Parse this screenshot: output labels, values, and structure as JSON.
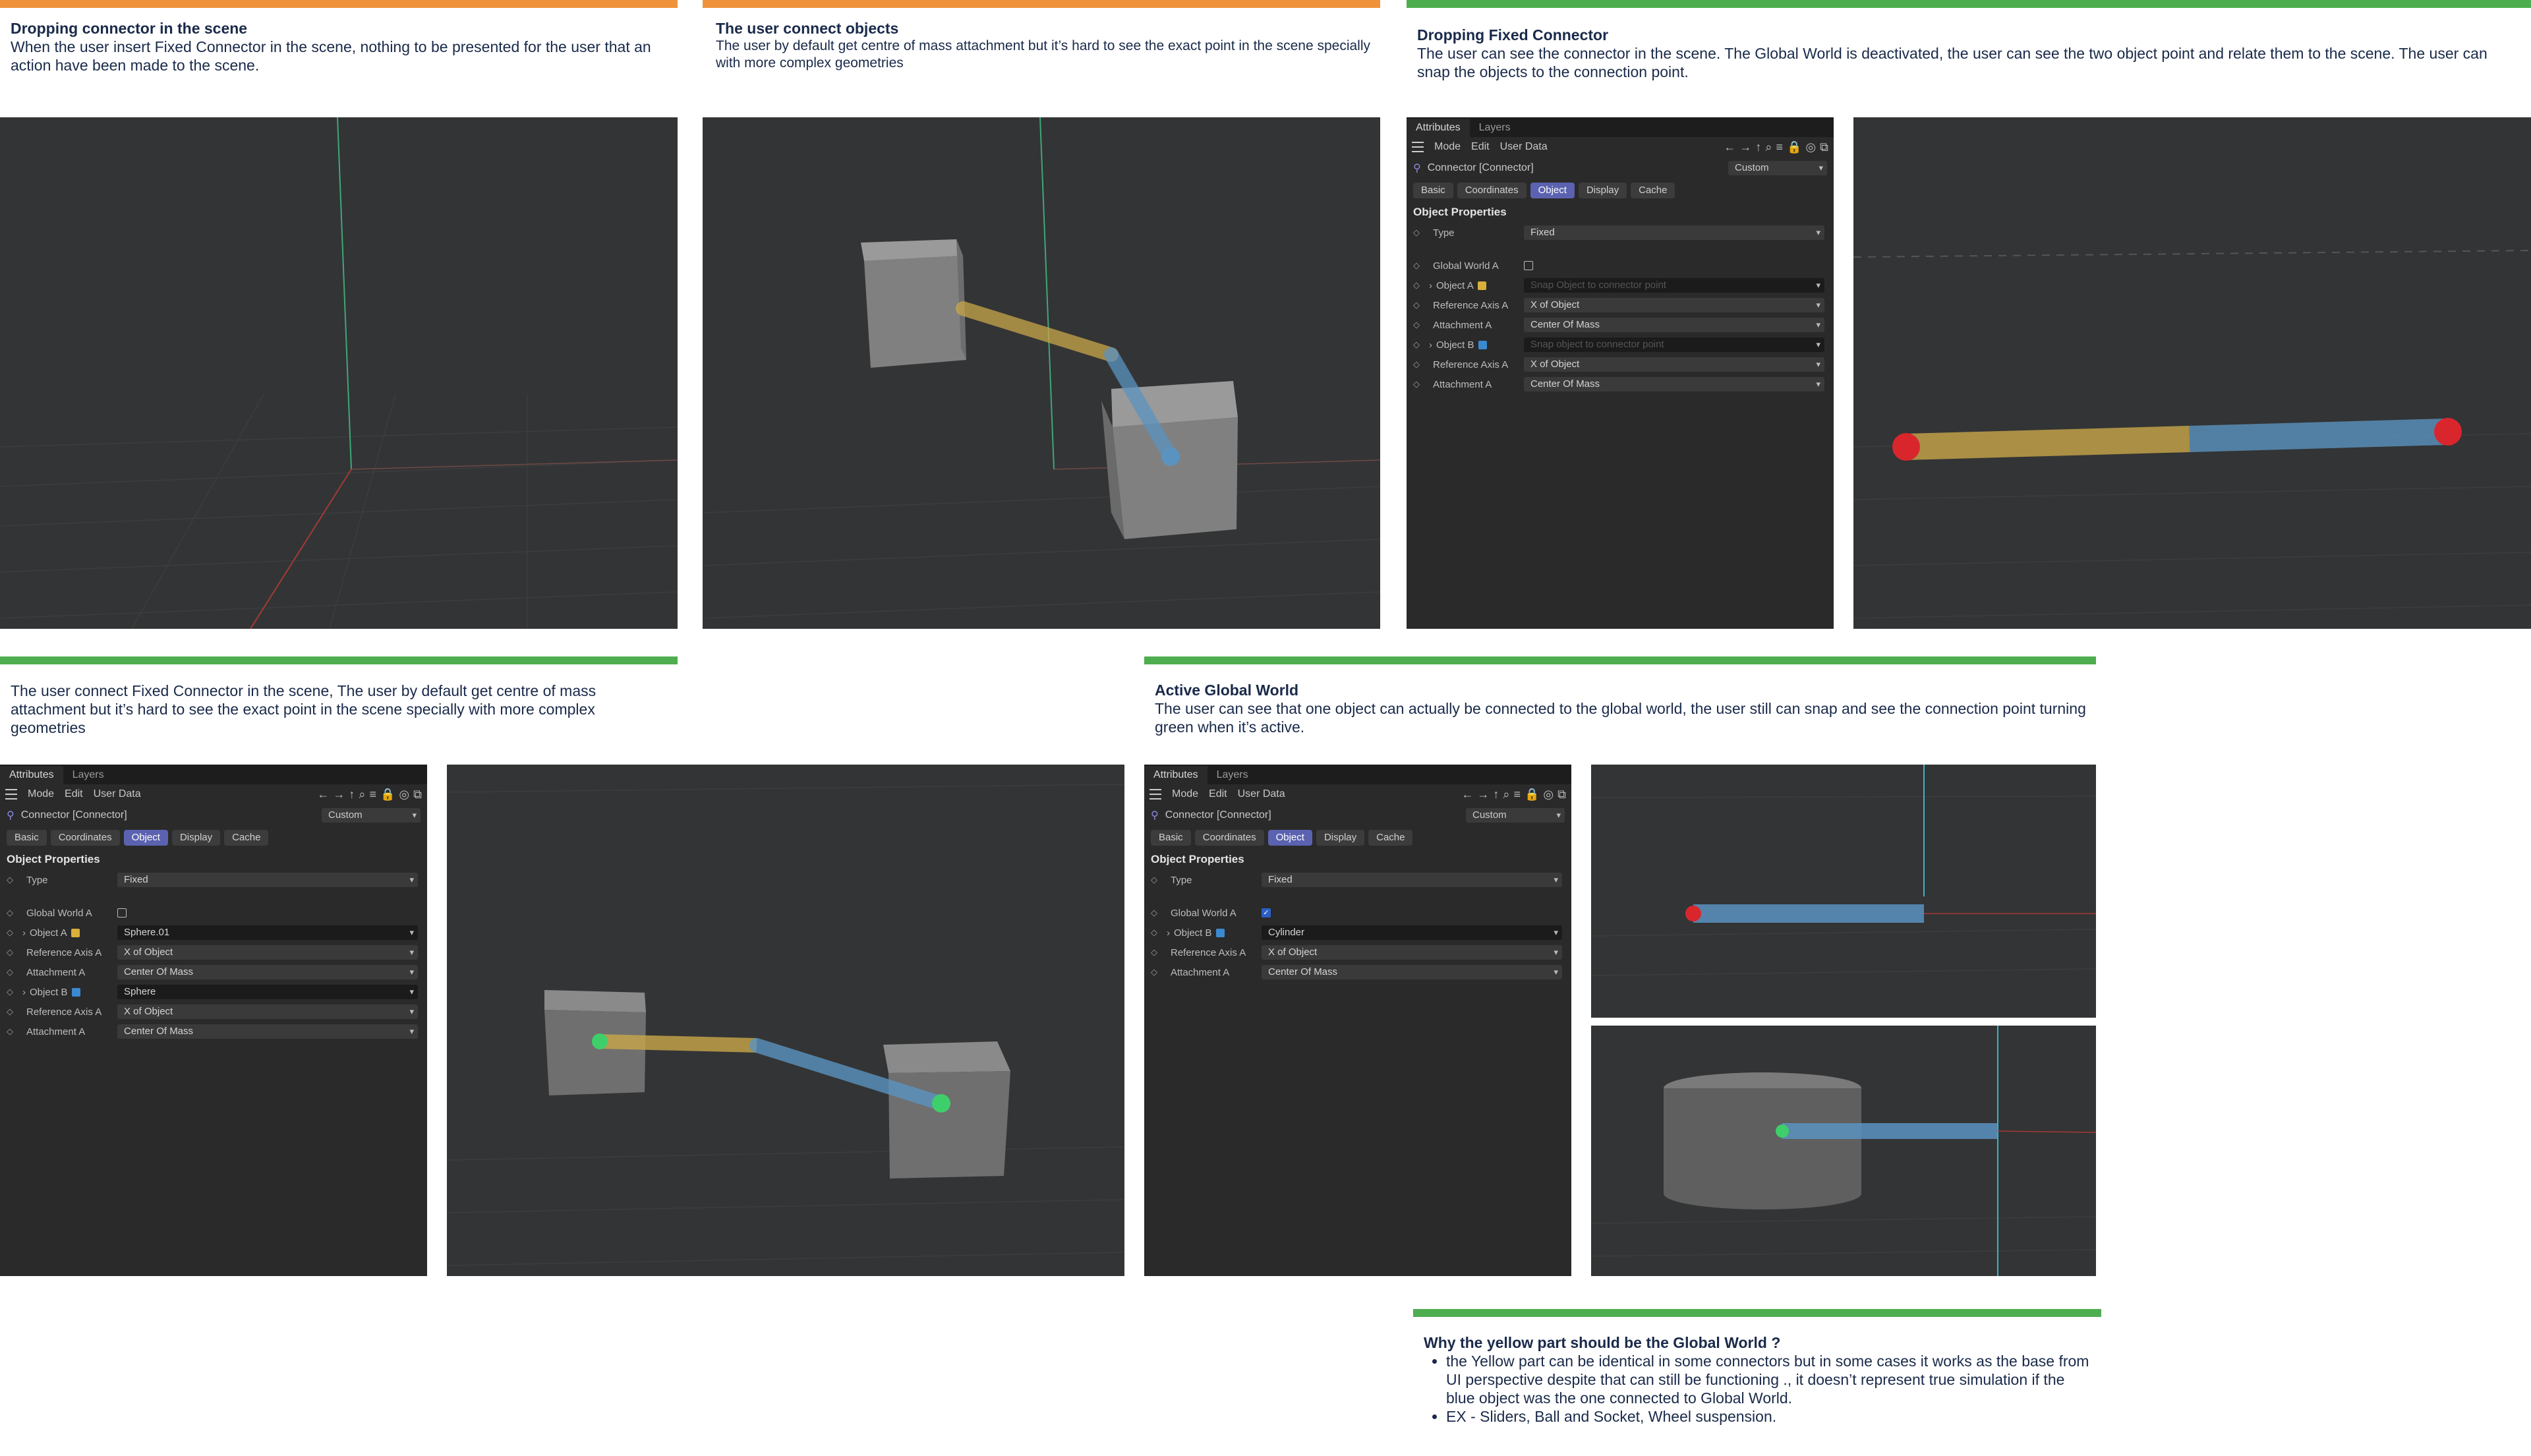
{
  "sections": {
    "s1": {
      "title": "Dropping connector in the scene",
      "body": "When the user insert Fixed Connector in the scene, nothing to be presented for the user that an action have been made to the scene."
    },
    "s2": {
      "title": "The user connect objects",
      "body": "The user by default get centre of mass attachment but it’s hard to see the exact point in the scene specially with more complex geometries"
    },
    "s3": {
      "title": "Dropping Fixed Connector",
      "body": "The user can see the connector in the scene. The Global World is deactivated, the user can see the two object point and relate them to the scene. The user can snap the objects to the connection point."
    },
    "s4": {
      "body": "The user connect Fixed Connector in the scene, The user by default get centre of mass attachment but it’s hard to see the exact point in the scene specially with more complex geometries"
    },
    "s5": {
      "title": "Active Global World",
      "body": "The user can see that one object can actually be connected to the global world, the user still can snap and see the connection point turning green when it’s active."
    },
    "s6": {
      "title": "Why the yellow part should be the Global World ?",
      "bullets": [
        "the Yellow part can be identical in some connectors but in some cases it works as the base from UI perspective despite that can still be functioning ., it doesn’t represent true simulation if the blue object was the one connected to Global World.",
        "EX - Sliders, Ball and Socket, Wheel suspension."
      ]
    }
  },
  "panel": {
    "tabs": [
      "Attributes",
      "Layers"
    ],
    "toolbar": [
      "Mode",
      "Edit",
      "User Data"
    ],
    "object_name": "Connector [Connector]",
    "preset": "Custom",
    "subtabs": [
      "Basic",
      "Coordinates",
      "Object",
      "Display",
      "Cache"
    ],
    "section": "Object Properties",
    "labels": {
      "type": "Type",
      "global_world": "Global World A",
      "object_a": "Object A",
      "ref_axis": "Reference Axis A",
      "attachment": "Attachment A",
      "object_b": "Object B"
    },
    "type_value": "Fixed",
    "ref_axis_value": "X of Object",
    "attachment_value": "Center Of Mass",
    "p1": {
      "object_a_placeholder": "Snap Object to connector point",
      "object_b_placeholder": "Snap object to connector point"
    },
    "p2": {
      "object_a": "Sphere.01",
      "object_b": "Sphere"
    },
    "p3": {
      "object_b": "Cylinder"
    }
  },
  "colors": {
    "orange_bar": "#f0923a",
    "green_bar": "#4ead4e",
    "viewport_bg": "#333435",
    "panel_bg": "#2a2a2a",
    "active_tab": "#5b62b0",
    "yellow_link": "#c8a64a",
    "blue_link": "#5a93c0",
    "red_end": "#d9262c",
    "green_end": "#3fcf6a"
  }
}
